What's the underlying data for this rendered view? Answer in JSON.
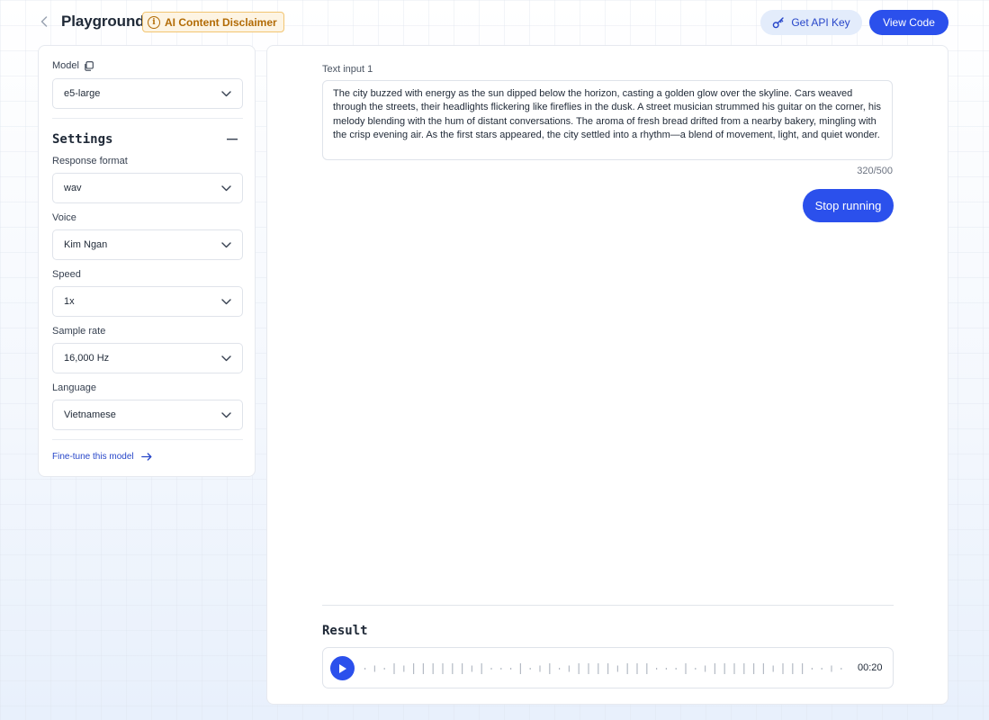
{
  "header": {
    "title": "Playground",
    "disclaimer": "AI Content Disclaimer",
    "api_key_label": "Get API Key",
    "view_code_label": "View Code"
  },
  "sidebar": {
    "model_label": "Model",
    "model_value": "e5-large",
    "settings_title": "Settings",
    "fields": [
      {
        "label": "Response format",
        "value": "wav"
      },
      {
        "label": "Voice",
        "value": "Kim Ngan"
      },
      {
        "label": "Speed",
        "value": "1x"
      },
      {
        "label": "Sample rate",
        "value": "16,000 Hz"
      },
      {
        "label": "Language",
        "value": "Vietnamese"
      }
    ],
    "finetune_label": "Fine-tune this model"
  },
  "main": {
    "input_label": "Text input 1",
    "input_text": "The city buzzed with energy as the sun dipped below the horizon, casting a golden glow over the skyline. Cars weaved through the streets, their headlights flickering like fireflies in the dusk. A street musician strummed his guitar on the corner, his melody blending with the hum of distant conversations. The aroma of fresh bread drifted from a nearby bakery, mingling with the crisp evening air. As the first stars appeared, the city settled into a rhythm—a blend of movement, light, and quiet wonder.",
    "char_counter": "320/500",
    "stop_label": "Stop running",
    "result_title": "Result",
    "audio_time": "00:20"
  },
  "colors": {
    "accent": "#2b50ec",
    "warning": "#b26b05",
    "link": "#2746c9"
  }
}
